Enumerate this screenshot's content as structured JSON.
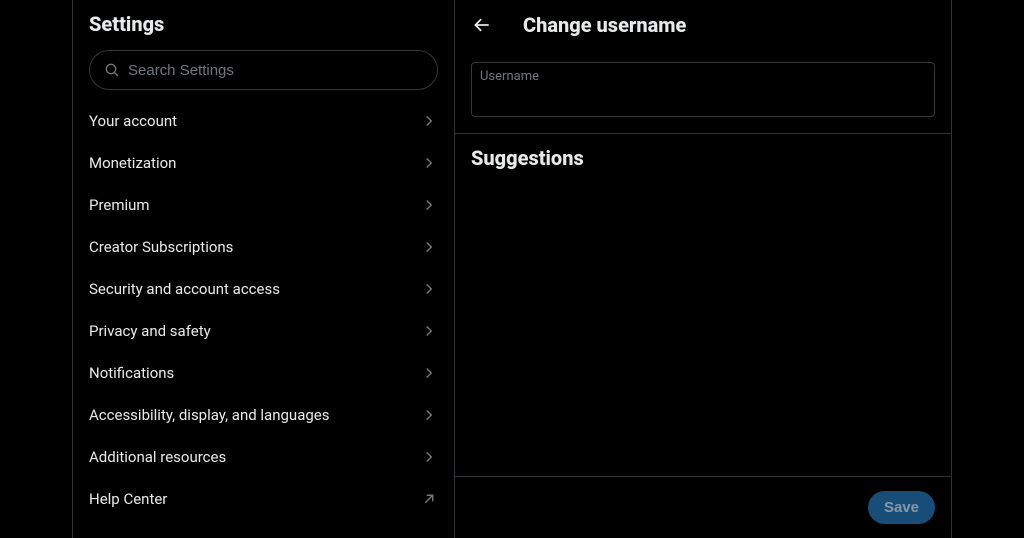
{
  "settings": {
    "title": "Settings",
    "search_placeholder": "Search Settings",
    "items": [
      {
        "label": "Your account",
        "external": false
      },
      {
        "label": "Monetization",
        "external": false
      },
      {
        "label": "Premium",
        "external": false
      },
      {
        "label": "Creator Subscriptions",
        "external": false
      },
      {
        "label": "Security and account access",
        "external": false
      },
      {
        "label": "Privacy and safety",
        "external": false
      },
      {
        "label": "Notifications",
        "external": false
      },
      {
        "label": "Accessibility, display, and languages",
        "external": false
      },
      {
        "label": "Additional resources",
        "external": false
      },
      {
        "label": "Help Center",
        "external": true
      }
    ]
  },
  "detail": {
    "title": "Change username",
    "field_label": "Username",
    "field_value": "",
    "suggestions_title": "Suggestions",
    "save_label": "Save"
  }
}
